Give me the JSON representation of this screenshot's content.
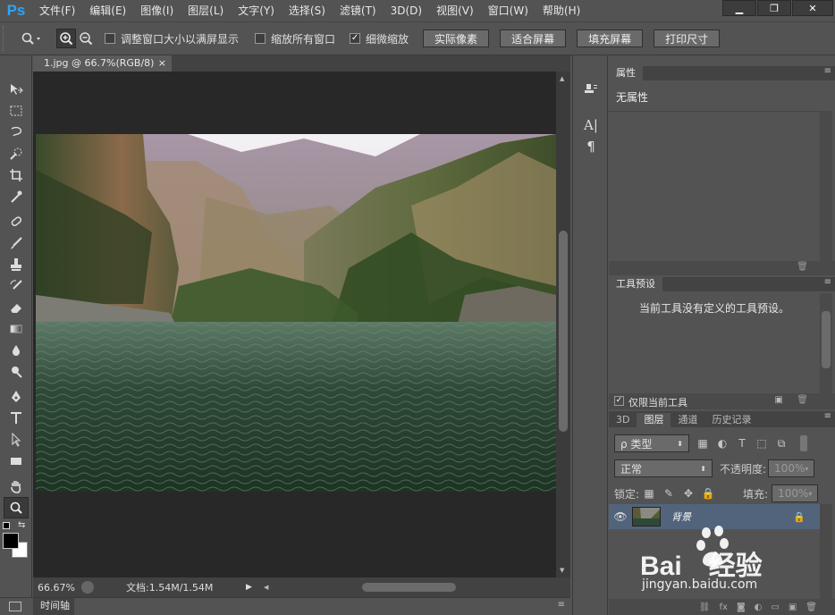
{
  "app": {
    "logo": "Ps"
  },
  "menu": [
    "文件(F)",
    "编辑(E)",
    "图像(I)",
    "图层(L)",
    "文字(Y)",
    "选择(S)",
    "滤镜(T)",
    "3D(D)",
    "视图(V)",
    "窗口(W)",
    "帮助(H)"
  ],
  "window_buttons": [
    "▁",
    "❐",
    "✕"
  ],
  "options": {
    "checkbox_fit": "调整窗口大小以满屏显示",
    "checkbox_all": "缩放所有窗口",
    "checkbox_scrubby": "细微缩放",
    "scrubby_checked": true,
    "btn_actual": "实际像素",
    "btn_fit": "适合屏幕",
    "btn_fill": "填充屏幕",
    "btn_print": "打印尺寸"
  },
  "document": {
    "tab_title": "1.jpg @ 66.7%(RGB/8)",
    "tab_close": "×",
    "zoom": "66.67%",
    "doc_size": "文档:1.54M/1.54M"
  },
  "timeline_tab": "时间轴",
  "properties_panel": {
    "tab": "属性",
    "body": "无属性"
  },
  "presets_panel": {
    "tab": "工具预设",
    "message": "当前工具没有定义的工具预设。",
    "current_tool_only": "仅限当前工具"
  },
  "layers_panel": {
    "tabs": [
      "3D",
      "图层",
      "通道",
      "历史记录"
    ],
    "active_tab": "图层",
    "filter_label": "ρ 类型",
    "blend_mode": "正常",
    "opacity_label": "不透明度:",
    "opacity_value": "100%",
    "lock_label": "锁定:",
    "fill_label": "填充:",
    "fill_value": "100%",
    "layer_name": "背景"
  },
  "watermark": {
    "brand": "Bai",
    "brand2": "经验",
    "url": "jingyan.baidu.com"
  },
  "colors": {
    "accent": "#2fa3f5",
    "panel_bg": "#535353",
    "canvas_bg": "#282828",
    "layer_selected": "#52647c"
  }
}
